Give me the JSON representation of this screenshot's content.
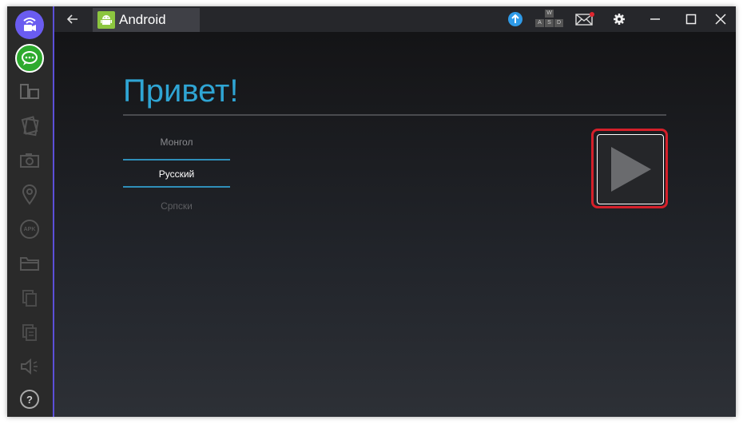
{
  "window": {
    "app_tab_label": "Android",
    "keyboard_keys": [
      "W",
      "A",
      "S",
      "D"
    ]
  },
  "sidebar": {
    "items": [
      {
        "name": "video-call-icon",
        "color": "#6a5cf0"
      },
      {
        "name": "chat-icon",
        "color": "#2eaa2e"
      },
      {
        "name": "rotate-screen-icon"
      },
      {
        "name": "cards-icon"
      },
      {
        "name": "camera-icon"
      },
      {
        "name": "location-pin-icon"
      },
      {
        "name": "apk-icon",
        "label": "APK"
      },
      {
        "name": "folder-icon"
      },
      {
        "name": "copy-icon"
      },
      {
        "name": "paste-icon"
      },
      {
        "name": "volume-icon"
      },
      {
        "name": "help-icon",
        "label": "?"
      }
    ]
  },
  "main": {
    "greeting": "Привет!",
    "languages": [
      "Монгол",
      "Русский",
      "Српски"
    ],
    "selected_language": "Русский"
  },
  "colors": {
    "accent_blue": "#2fa5d4",
    "highlight_red": "#d5202a",
    "sidebar_border": "#5b4fd9"
  }
}
